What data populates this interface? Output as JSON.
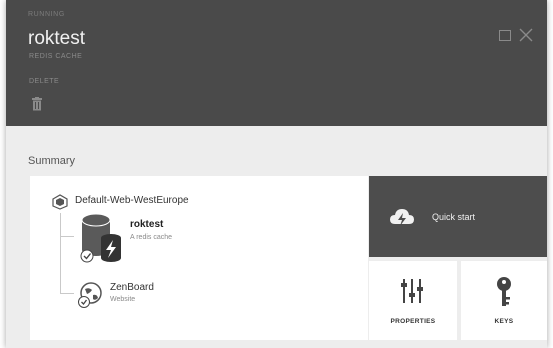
{
  "header": {
    "status": "RUNNING",
    "title": "roktest",
    "subtitle": "REDIS CACHE",
    "commands": {
      "delete_label": "DELETE"
    }
  },
  "summary": {
    "section_label": "Summary",
    "resource_group": "Default-Web-WestEurope",
    "resources": [
      {
        "name": "roktest",
        "description": "A redis cache",
        "icon": "redis-cache-icon"
      },
      {
        "name": "ZenBoard",
        "description": "Website",
        "icon": "website-icon"
      }
    ]
  },
  "tiles": {
    "quick_start": "Quick start",
    "properties": "PROPERTIES",
    "keys": "KEYS"
  },
  "colors": {
    "header_bg": "#4a4a4a",
    "body_bg": "#ededed",
    "tile_dark": "#4d4d4d",
    "card_bg": "#ffffff"
  }
}
